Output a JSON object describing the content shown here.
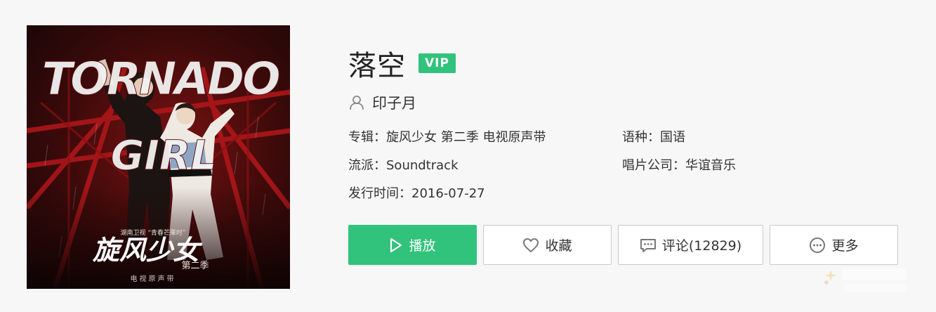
{
  "song": {
    "title": "落空",
    "vip_badge": "VIP",
    "singer": "印子月"
  },
  "cover": {
    "headline_top": "TORNADO",
    "headline_bottom": "GIRL",
    "network_caption": "湖南卫视 “青春芒果时”",
    "calligraphy_title": "旋风少女",
    "season_text": "第二季",
    "footer_text": "电视原声带"
  },
  "meta": {
    "album": {
      "label": "专辑：",
      "value": "旋风少女 第二季 电视原声带"
    },
    "language": {
      "label": "语种：",
      "value": "国语"
    },
    "genre": {
      "label": "流派：",
      "value": "Soundtrack"
    },
    "label_company": {
      "label": "唱片公司：",
      "value": "华谊音乐"
    },
    "release": {
      "label": "发行时间：",
      "value": "2016-07-27"
    }
  },
  "actions": {
    "play_label": "播放",
    "favorite_label": "收藏",
    "comment_label": "评论(12829)",
    "more_label": "更多"
  },
  "colors": {
    "accent": "#31c27c",
    "page_bg": "#f7f7f7",
    "border": "#c9c9c9"
  },
  "icons": {
    "singer": "user-icon",
    "play": "play-triangle-icon",
    "favorite": "heart-icon",
    "comment": "comment-bubble-icon",
    "more": "more-dots-icon"
  }
}
